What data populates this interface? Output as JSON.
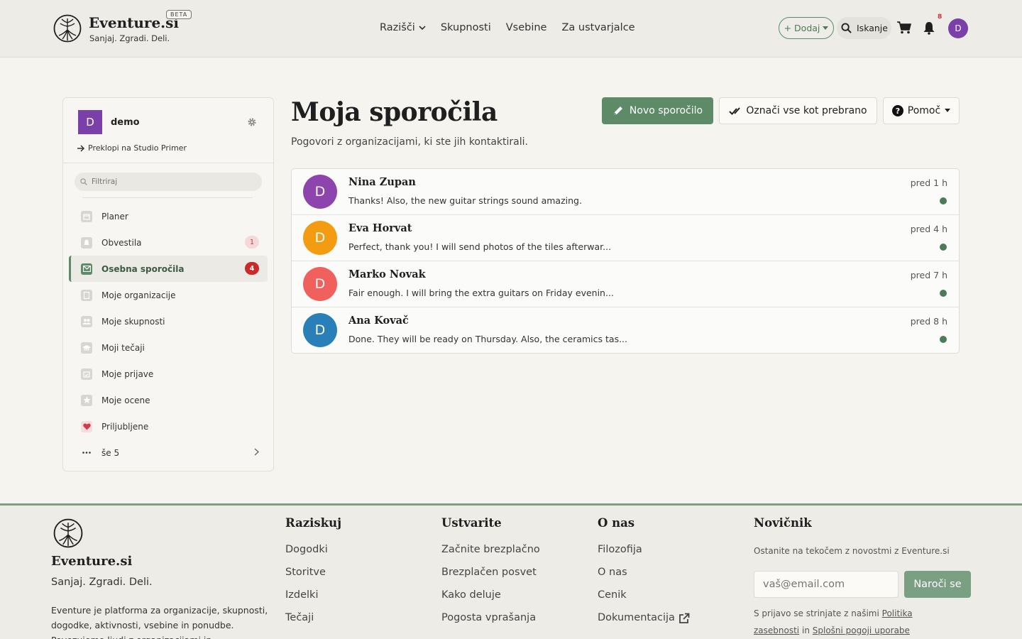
{
  "header": {
    "brand": "Eventure.si",
    "beta": "BETA",
    "tagline": "Sanjaj. Zgradi. Deli.",
    "nav": {
      "explore": "Razišči",
      "communities": "Skupnosti",
      "content": "Vsebine",
      "creators": "Za ustvarjalce"
    },
    "add_label": "+ Dodaj",
    "search_label": "Iskanje",
    "notification_count": "8",
    "avatar_letter": "D"
  },
  "sidebar": {
    "user_initial": "D",
    "username": "demo",
    "switch_label": "Preklopi na Studio Primer",
    "filter_placeholder": "Filtriraj",
    "items": [
      {
        "label": "Planer",
        "icon": "calendar-icon"
      },
      {
        "label": "Obvestila",
        "icon": "bell-icon",
        "badge": "1"
      },
      {
        "label": "Osebna sporočila",
        "icon": "envelope-icon",
        "badge": "4"
      },
      {
        "label": "Moje organizacije",
        "icon": "building-icon"
      },
      {
        "label": "Moje skupnosti",
        "icon": "users-icon"
      },
      {
        "label": "Moji tečaji",
        "icon": "graduation-cap-icon"
      },
      {
        "label": "Moje prijave",
        "icon": "calendar-check-icon"
      },
      {
        "label": "Moje ocene",
        "icon": "star-icon"
      },
      {
        "label": "Priljubljene",
        "icon": "heart-icon"
      },
      {
        "label": "še 5",
        "icon": "ellipsis-icon"
      }
    ]
  },
  "main": {
    "title": "Moja sporočila",
    "subtitle": "Pogovori z organizacijami, ki ste jih kontaktirali.",
    "new_message": "Novo sporočilo",
    "mark_read": "Označi vse kot prebrano",
    "help": "Pomoč",
    "messages": [
      {
        "initial": "D",
        "name": "Nina Zupan",
        "text": "Thanks! Also, the new guitar strings sound amazing.",
        "time": "pred 1 h",
        "color": "#8e44ad"
      },
      {
        "initial": "D",
        "name": "Eva Horvat",
        "text": "Perfect, thank you! I will send photos of the tiles afterwar...",
        "time": "pred 4 h",
        "color": "#f39c12"
      },
      {
        "initial": "D",
        "name": "Marko Novak",
        "text": "Fair enough. I will bring the extra guitars on Friday evenin...",
        "time": "pred 7 h",
        "color": "#f0605d"
      },
      {
        "initial": "D",
        "name": "Ana Kovač",
        "text": "Done. They will be ready on Thursday. Also, the ceramics tas...",
        "time": "pred 8 h",
        "color": "#2980b9"
      }
    ]
  },
  "footer": {
    "brand": "Eventure.si",
    "tagline": "Sanjaj. Zgradi. Deli.",
    "description": "Eventure je platforma za organizacije, skupnosti, dogodke, aktivnosti, vsebine in ponudbe. Povezujemo ljudi z organizacijami in",
    "explore": {
      "title": "Raziskuj",
      "links": [
        "Dogodki",
        "Storitve",
        "Izdelki",
        "Tečaji"
      ]
    },
    "create": {
      "title": "Ustvarite",
      "links": [
        "Začnite brezplačno",
        "Brezplačen posvet",
        "Kako deluje",
        "Pogosta vprašanja"
      ]
    },
    "about": {
      "title": "O nas",
      "links": [
        "Filozofija",
        "O nas",
        "Cenik",
        "Dokumentacija"
      ]
    },
    "newsletter": {
      "title": "Novičnik",
      "text": "Ostanite na tekočem z novostmi z Eventure.si",
      "placeholder": "vaš@email.com",
      "button": "Naroči se",
      "terms_prefix": "S prijavo se strinjate z našimi",
      "privacy": "Politika zasebnosti",
      "and": "in",
      "terms": "Splošni pogoji uporabe"
    }
  },
  "colors": {
    "accent": "#5d8a67",
    "avatar_purple": "#7a3fa8",
    "badge_red": "#cc2929"
  }
}
